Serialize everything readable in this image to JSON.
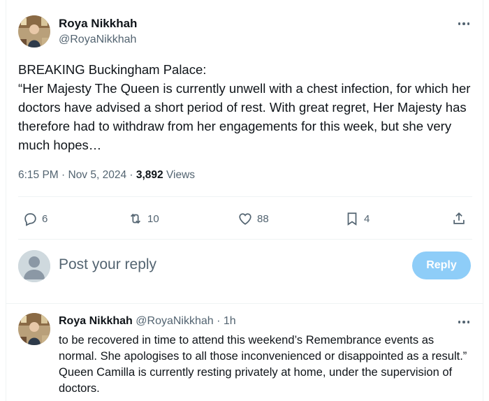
{
  "main_tweet": {
    "author_name": "Roya Nikkhah",
    "author_handle": "@RoyaNikkhah",
    "text": "BREAKING Buckingham Palace:\n“Her Majesty The Queen is currently unwell with a chest infection, for which her doctors have advised a short period of rest. With great regret, Her Majesty has therefore had to withdraw from her engagements for this week, but she very much hopes…",
    "timestamp": "6:15 PM · Nov 5, 2024",
    "separator": " · ",
    "views_count": "3,892",
    "views_label": "Views",
    "more_icon": "more-horizontal-icon"
  },
  "actions": {
    "reply": {
      "icon": "reply-icon",
      "count": "6"
    },
    "retweet": {
      "icon": "retweet-icon",
      "count": "10"
    },
    "like": {
      "icon": "heart-icon",
      "count": "88"
    },
    "bookmark": {
      "icon": "bookmark-icon",
      "count": "4"
    },
    "share": {
      "icon": "share-icon"
    }
  },
  "reply_composer": {
    "placeholder": "Post your reply",
    "button_label": "Reply",
    "button_color": "#8ecdf8"
  },
  "thread_reply": {
    "author_name": "Roya Nikkhah",
    "author_handle": "@RoyaNikkhah",
    "dot": "·",
    "time": "1h",
    "text": "to be recovered in time to attend this weekend’s Remembrance events as normal. She apologises to all those inconvenienced or disappointed as a result.” Queen Camilla is currently resting privately at home, under the supervision of doctors."
  },
  "colors": {
    "text_primary": "#0f1419",
    "text_secondary": "#536471",
    "divider": "#eff3f4"
  }
}
